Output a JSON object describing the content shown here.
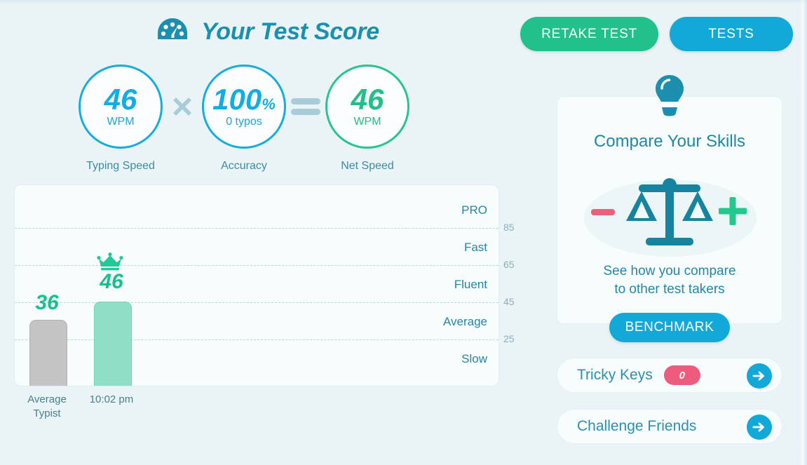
{
  "header": {
    "title": "Your Test Score",
    "gauge_icon": "speedometer-icon",
    "retake_label": "RETAKE TEST",
    "tests_label": "TESTS",
    "retake_color": "#22c08a",
    "tests_color": "#12a9d9"
  },
  "scores": {
    "typing_speed": {
      "value": "46",
      "unit": "WPM",
      "caption": "Typing Speed",
      "color": "#14ade1"
    },
    "operator_1": "×",
    "accuracy": {
      "value": "100",
      "suffix": "%",
      "unit": "0  typos",
      "caption": "Accuracy",
      "color": "#14ade1"
    },
    "operator_2": "=",
    "net_speed": {
      "value": "46",
      "unit": "WPM",
      "caption": "Net Speed",
      "color": "#22bf86"
    }
  },
  "chart_data": {
    "type": "bar",
    "title": "",
    "xlabel": "",
    "ylabel": "",
    "ylim": [
      0,
      105
    ],
    "grid": true,
    "categories": [
      "Average Typist",
      "10:02 pm"
    ],
    "values": [
      36,
      46
    ],
    "bar_colors": [
      "#c4c4c4",
      "#8edfc6"
    ],
    "value_labels": [
      "36",
      "46"
    ],
    "crown_on_index": 1,
    "crown_icon": "crown-icon",
    "gridline_values": [
      85,
      65,
      45,
      25
    ],
    "tick_labels": [
      "85",
      "65",
      "45",
      "25"
    ],
    "band_labels": [
      "PRO",
      "Fast",
      "Fluent",
      "Average",
      "Slow"
    ]
  },
  "compare": {
    "bulb_icon": "lightbulb-icon",
    "title": "Compare Your Skills",
    "scale_icon": "balance-scale-icon",
    "minus_icon": "minus-icon",
    "plus_icon": "plus-icon",
    "text_line1": "See how you compare",
    "text_line2": "to other test takers",
    "benchmark_label": "BENCHMARK"
  },
  "actions": [
    {
      "label": "Tricky Keys",
      "badge": "0",
      "badge_color": "#ed5c7c",
      "arrow_icon": "arrow-right-icon"
    },
    {
      "label": "Challenge Friends",
      "badge": null,
      "arrow_icon": "arrow-right-icon"
    }
  ]
}
